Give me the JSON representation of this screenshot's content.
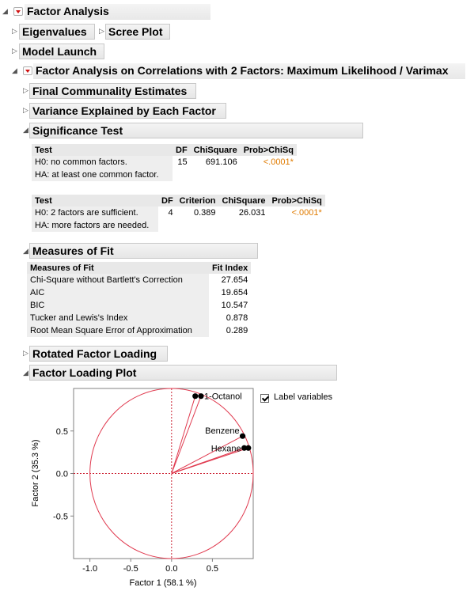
{
  "report": {
    "title": "Factor Analysis",
    "collapsed_items": [
      "Eigenvalues",
      "Scree Plot",
      "Model Launch"
    ],
    "fa_title": "Factor Analysis on Correlations with 2 Factors: Maximum Likelihood / Varimax",
    "sub_collapsed": [
      "Final Communality Estimates",
      "Variance Explained by Each Factor"
    ]
  },
  "significance": {
    "title": "Significance Test",
    "table1": {
      "headers": [
        "Test",
        "DF",
        "ChiSquare",
        "Prob>ChiSq"
      ],
      "rows": [
        [
          "H0: no common factors.",
          "15",
          "691.106",
          "<.0001*"
        ],
        [
          "HA: at least one common factor.",
          "",
          "",
          ""
        ]
      ]
    },
    "table2": {
      "headers": [
        "Test",
        "DF",
        "Criterion",
        "ChiSquare",
        "Prob>ChiSq"
      ],
      "rows": [
        [
          "H0: 2 factors are sufficient.",
          "4",
          "0.389",
          "26.031",
          "<.0001*"
        ],
        [
          "HA: more factors are needed.",
          "",
          "",
          "",
          ""
        ]
      ]
    }
  },
  "measures": {
    "title": "Measures of Fit",
    "headers": [
      "Measures of Fit",
      "Fit Index"
    ],
    "rows": [
      [
        "Chi-Square without Bartlett's Correction",
        "27.654"
      ],
      [
        "AIC",
        "19.654"
      ],
      [
        "BIC",
        "10.547"
      ],
      [
        "Tucker and Lewis's Index",
        "0.878"
      ],
      [
        "Root Mean Square Error of Approximation",
        "0.289"
      ]
    ]
  },
  "rotated": {
    "title": "Rotated Factor Loading"
  },
  "plot": {
    "title": "Factor Loading Plot",
    "label_variables": "Label variables",
    "label_variables_checked": true,
    "colors": {
      "circle": "#e03a4f",
      "ref": "#cc2233",
      "point": "#000000"
    }
  },
  "chart_data": {
    "type": "scatter",
    "xlabel": "Factor 1 (58.1 %)",
    "ylabel": "Factor 2 (35.3 %)",
    "xlim": [
      -1.2,
      1.0
    ],
    "ylim": [
      -1.0,
      1.0
    ],
    "x_ticks": [
      "-1.0",
      "-0.5",
      "0.0",
      "0.5"
    ],
    "x_tick_values": [
      -1.0,
      -0.5,
      0.0,
      0.5
    ],
    "y_ticks": [
      "0.5",
      "0.0",
      "-0.5"
    ],
    "y_tick_values": [
      0.5,
      0.0,
      -0.5
    ],
    "points": [
      {
        "x": 0.29,
        "y": 0.91,
        "label": ""
      },
      {
        "x": 0.36,
        "y": 0.91,
        "label": "1-Octanol"
      },
      {
        "x": 0.87,
        "y": 0.44,
        "label": "Benzene"
      },
      {
        "x": 0.89,
        "y": 0.3,
        "label": "Hexane"
      },
      {
        "x": 0.94,
        "y": 0.3,
        "label": ""
      }
    ],
    "unit_circle": true
  }
}
